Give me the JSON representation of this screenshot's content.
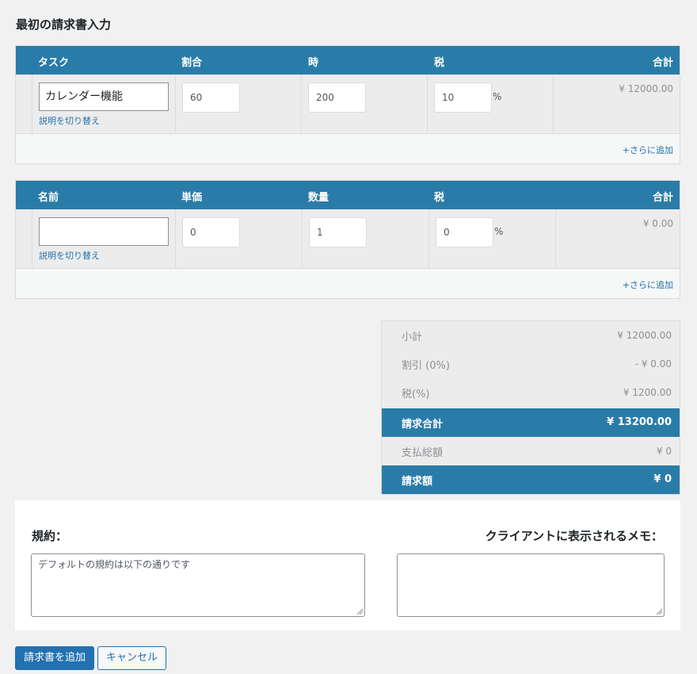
{
  "page_title": "最初の請求書入力",
  "tasks_table": {
    "headers": {
      "name": "タスク",
      "rate": "割合",
      "hours": "時",
      "tax": "税",
      "total": "合計"
    },
    "row": {
      "name": "カレンダー機能",
      "toggle_desc": "説明を切り替え",
      "rate": "60",
      "hours": "200",
      "tax": "10",
      "pct": "%",
      "total": "¥ 12000.00"
    },
    "add_more": "+さらに追加"
  },
  "items_table": {
    "headers": {
      "name": "名前",
      "price": "単価",
      "qty": "数量",
      "tax": "税",
      "total": "合計"
    },
    "row": {
      "name": "",
      "toggle_desc": "説明を切り替え",
      "price": "0",
      "qty": "1",
      "tax": "0",
      "pct": "%",
      "total": "¥ 0.00"
    },
    "add_more": "+さらに追加"
  },
  "summary": {
    "subtotal_label": "小計",
    "subtotal_value": "¥ 12000.00",
    "discount_label": "割引 (0%)",
    "discount_value": "- ¥ 0.00",
    "tax_label": "税(%)",
    "tax_value": "¥ 1200.00",
    "invoice_total_label": "請求合計",
    "invoice_total_value": "¥ 13200.00",
    "paid_label": "支払総額",
    "paid_value": "¥ 0",
    "due_label": "請求額",
    "due_value": "¥ 0"
  },
  "notes": {
    "terms_label": "規約：",
    "terms_value": "デフォルトの規約は以下の通りです",
    "memo_label": "クライアントに表示されるメモ：",
    "memo_value": ""
  },
  "buttons": {
    "submit": "請求書を追加",
    "cancel": "キャンセル"
  },
  "colors": {
    "header_bg": "#2a7ca8",
    "primary": "#2271b1",
    "link": "#2271b1"
  }
}
